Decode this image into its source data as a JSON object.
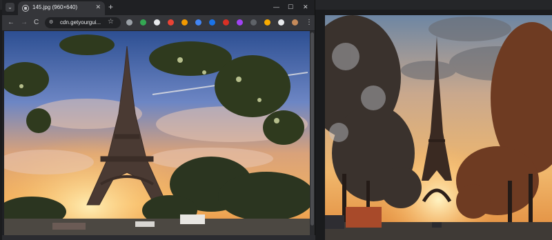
{
  "browser": {
    "tab": {
      "title": "145.jpg (960×640)"
    },
    "new_tab_label": "+",
    "window_controls": {
      "minimize": "—",
      "maximize": "☐",
      "close": "✕"
    },
    "nav": {
      "back": "←",
      "forward": "→",
      "reload": "C"
    },
    "address_bar": {
      "url": "cdn.getyourgui..."
    },
    "bookmark_star": "☆",
    "menu_dots": "⋮",
    "extensions": [
      {
        "name": "download-ext-icon",
        "color": "#9aa0a6"
      },
      {
        "name": "green-ext-icon",
        "color": "#34a853"
      },
      {
        "name": "diamond-ext-icon",
        "color": "#e8eaed"
      },
      {
        "name": "youtube-ext-icon",
        "color": "#ea4335"
      },
      {
        "name": "orange-ext-icon",
        "color": "#f29900"
      },
      {
        "name": "globe-ext-icon",
        "color": "#4285f4"
      },
      {
        "name": "eye-ext-icon",
        "color": "#1a73e8"
      },
      {
        "name": "red-ext-icon",
        "color": "#d93025"
      },
      {
        "name": "purple-ext-icon",
        "color": "#a142f4"
      },
      {
        "name": "grey-ext-icon",
        "color": "#5f6368"
      },
      {
        "name": "yellow-ext-icon",
        "color": "#f9ab00"
      },
      {
        "name": "puzzle-ext-icon",
        "color": "#e8eaed"
      },
      {
        "name": "profile-avatar-icon",
        "color": "#c58a5a"
      }
    ]
  },
  "colors": {
    "sky_top": "#2e4f8f",
    "sky_glow": "#f2a65a",
    "tower": "#3a2e2a",
    "foliage": "#2f3a22",
    "dusk_sky": "#c9b9a3",
    "dusk_sun": "#ffd27a"
  }
}
